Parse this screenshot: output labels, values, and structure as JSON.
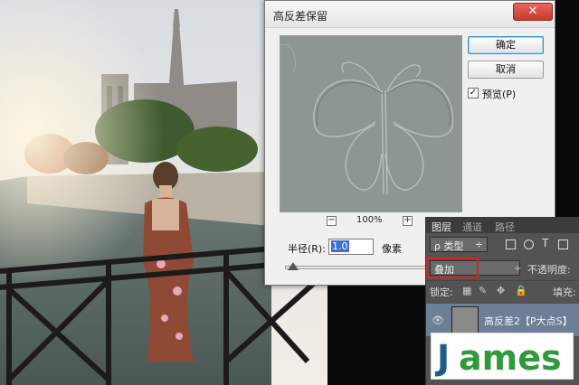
{
  "dialog": {
    "title": "高反差保留",
    "close_glyph": "✕",
    "ok_label": "确定",
    "cancel_label": "取消",
    "preview_label": "预览(P)",
    "preview_checked_glyph": "✓",
    "zoom_value": "100%",
    "zoom_out_glyph": "−",
    "zoom_in_glyph": "+",
    "radius_label": "半径(R):",
    "radius_value": "1.0",
    "radius_unit": "像素"
  },
  "layers_panel": {
    "tabs": [
      "图层",
      "通道",
      "路径"
    ],
    "filter_label": "ρ 类型",
    "filter_arrow": "÷",
    "filter_T": "T",
    "blend_mode": "叠加",
    "blend_arrow": "÷",
    "opacity_label": "不透明度:",
    "lock_label": "锁定:",
    "lock_glyph": "🔒",
    "fill_label": "填充:",
    "layer_name": "高反差2【P大点S】",
    "eye_glyph": "👁"
  },
  "watermark": {
    "text": "James"
  },
  "colors": {
    "accent_blue": "#3a8fd8",
    "blend_highlight": "#e02020",
    "watermark_blue": "#1f5a8a",
    "watermark_green": "#2e9a3a"
  }
}
